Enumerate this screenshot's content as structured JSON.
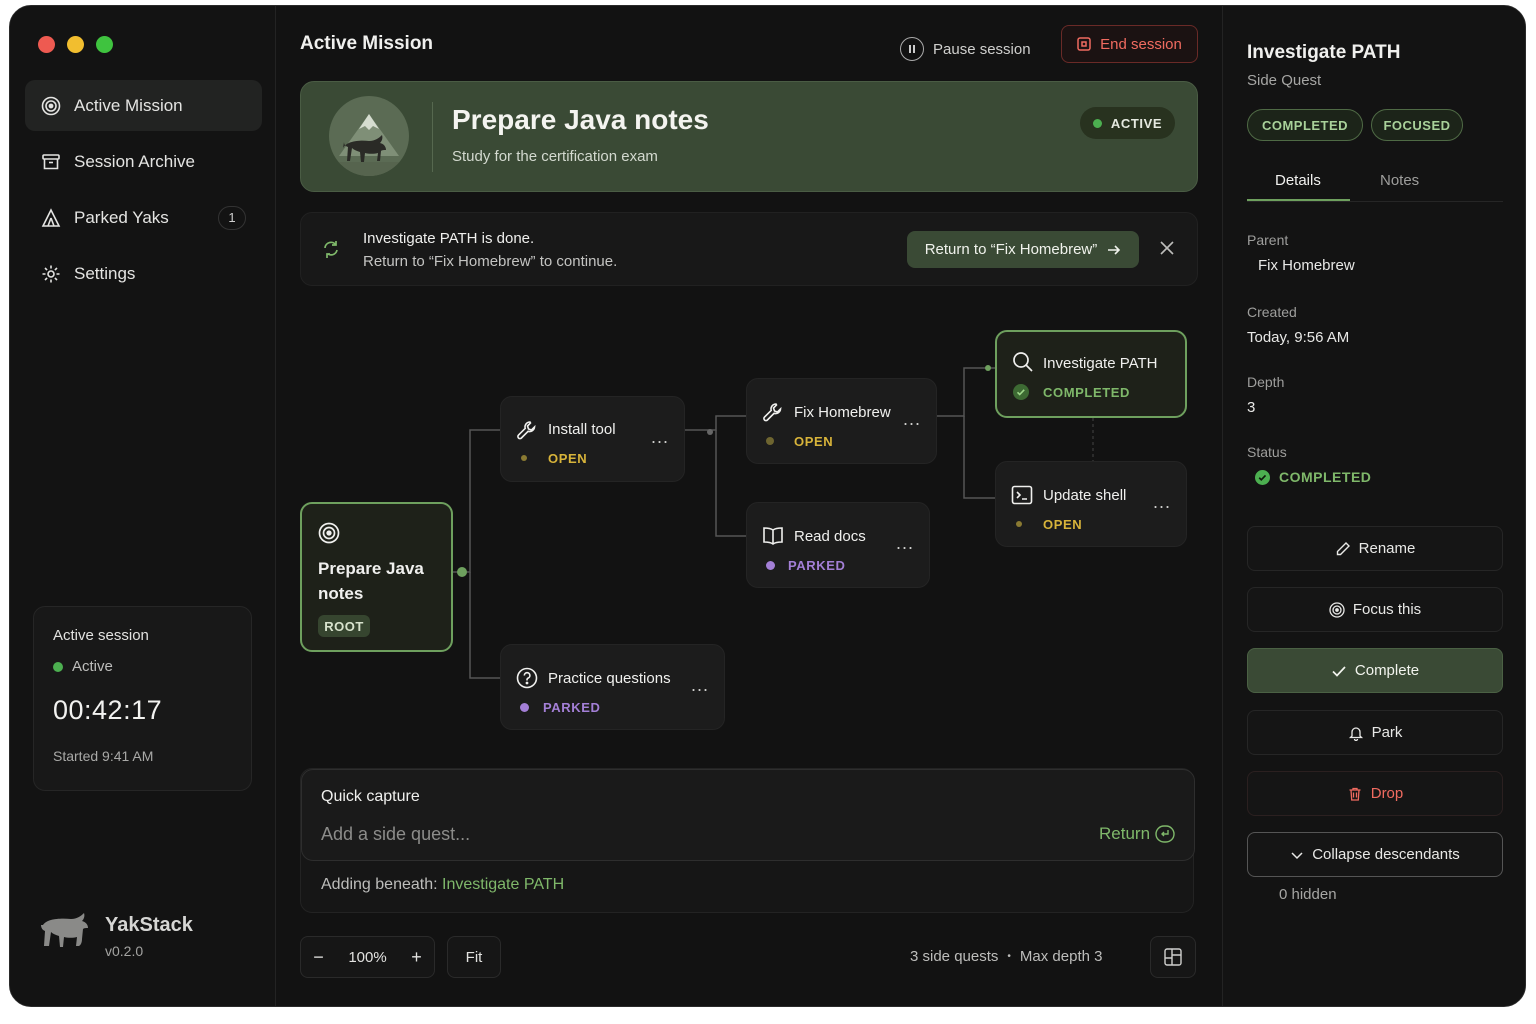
{
  "colors": {
    "accent": "#7fb86a",
    "accent_dark": "#3a4a35",
    "danger": "#f06b60",
    "open": "#d8b43a",
    "parked": "#a37fd6",
    "completed": "#4caf50"
  },
  "sidebar": {
    "items": [
      {
        "label": "Active Mission",
        "icon": "target-icon"
      },
      {
        "label": "Session Archive",
        "icon": "archive-icon"
      },
      {
        "label": "Parked Yaks",
        "icon": "tent-icon",
        "badge": "1"
      },
      {
        "label": "Settings",
        "icon": "gear-icon"
      }
    ],
    "session": {
      "title": "Active session",
      "status": "Active",
      "timer": "00:42:17",
      "started": "Started 9:41 AM"
    },
    "brand": {
      "name": "YakStack",
      "version": "v0.2.0"
    }
  },
  "header": {
    "title": "Active Mission",
    "pause_label": "Pause session",
    "end_label": "End session"
  },
  "mission": {
    "title": "Prepare Java notes",
    "subtitle": "Study for the certification exam",
    "status": "ACTIVE"
  },
  "notice": {
    "line1": "Investigate PATH is done.",
    "line2": "Return to “Fix Homebrew” to continue.",
    "button": "Return to “Fix Homebrew”"
  },
  "tree": {
    "root": {
      "title_line1": "Prepare Java",
      "title_line2": "notes",
      "tag": "ROOT"
    },
    "nodes": [
      {
        "title": "Install tool",
        "status": "OPEN"
      },
      {
        "title": "Fix Homebrew",
        "status": "OPEN"
      },
      {
        "title": "Investigate PATH",
        "status": "COMPLETED"
      },
      {
        "title": "Update shell",
        "status": "OPEN"
      },
      {
        "title": "Read docs",
        "status": "PARKED"
      },
      {
        "title": "Practice questions",
        "status": "PARKED"
      }
    ],
    "more": "..."
  },
  "quick_capture": {
    "heading": "Quick capture",
    "placeholder": "Add a side quest...",
    "return_label": "Return",
    "beneath_prefix": "Adding beneath:",
    "beneath_target": "Investigate PATH"
  },
  "footer": {
    "zoom": "100%",
    "minus": "−",
    "plus": "+",
    "fit": "Fit",
    "side_quests": "3 side quests",
    "sep": "•",
    "max_depth": "Max depth 3"
  },
  "details": {
    "title": "Investigate PATH",
    "subtitle": "Side Quest",
    "pills": [
      "COMPLETED",
      "FOCUSED"
    ],
    "tabs": [
      "Details",
      "Notes"
    ],
    "parent_label": "Parent",
    "parent_value": "Fix Homebrew",
    "created_label": "Created",
    "created_value": "Today, 9:56 AM",
    "depth_label": "Depth",
    "depth_value": "3",
    "status_label": "Status",
    "status_value": "COMPLETED",
    "actions": {
      "rename": "Rename",
      "focus": "Focus this",
      "complete": "Complete",
      "park": "Park",
      "drop": "Drop",
      "collapse": "Collapse descendants"
    },
    "hidden": "0 hidden"
  }
}
